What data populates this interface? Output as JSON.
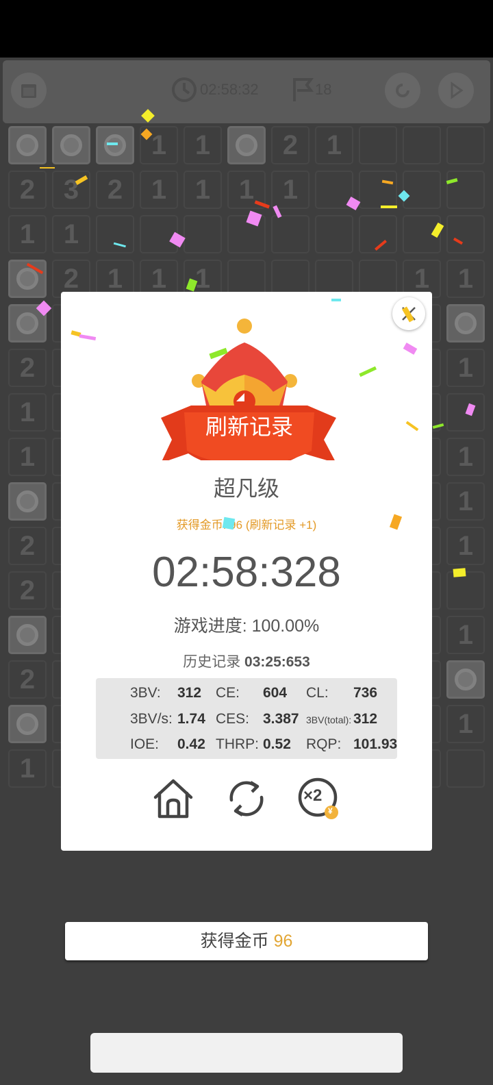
{
  "toolbar": {
    "timer": "02:58:32",
    "flags": "18"
  },
  "board": {
    "rows": [
      [
        "c",
        "c",
        "c",
        "1",
        "1",
        "c",
        "2",
        "1",
        "",
        "",
        ""
      ],
      [
        "2",
        "3",
        "2",
        "1",
        "1",
        "1",
        "1",
        "",
        "",
        "",
        ""
      ],
      [
        "1",
        "1",
        "",
        "",
        "",
        "",
        "",
        "",
        "",
        "",
        ""
      ],
      [
        "c",
        "2",
        "1",
        "1",
        "1",
        "",
        "",
        "",
        "",
        "1",
        "1"
      ],
      [
        "c",
        "",
        "",
        "",
        "",
        "",
        "",
        "",
        "",
        "",
        "c"
      ],
      [
        "2",
        "",
        "",
        "",
        "",
        "",
        "",
        "",
        "",
        "",
        "1"
      ],
      [
        "1",
        "",
        "",
        "",
        "",
        "",
        "",
        "",
        "",
        "",
        ""
      ],
      [
        "1",
        "",
        "",
        "",
        "",
        "",
        "",
        "",
        "",
        "",
        "1"
      ],
      [
        "c",
        "",
        "",
        "",
        "",
        "",
        "",
        "",
        "",
        "",
        "1"
      ],
      [
        "2",
        "",
        "",
        "",
        "",
        "",
        "",
        "",
        "",
        "",
        "1"
      ],
      [
        "2",
        "",
        "",
        "",
        "",
        "",
        "",
        "",
        "",
        "",
        ""
      ],
      [
        "c",
        "",
        "",
        "",
        "",
        "",
        "",
        "",
        "",
        "",
        "1"
      ],
      [
        "2",
        "",
        "",
        "",
        "",
        "",
        "",
        "",
        "",
        "",
        "c"
      ],
      [
        "c",
        "",
        "",
        "",
        "",
        "",
        "",
        "",
        "",
        "",
        "1"
      ],
      [
        "1",
        "",
        "",
        "",
        "",
        "",
        "",
        "",
        "",
        "",
        ""
      ]
    ]
  },
  "dialog": {
    "banner_text": "刷新记录",
    "level_name": "超凡级",
    "coins_earned_text": "获得金币: 96 (刷新记录 +1)",
    "time": "02:58:328",
    "progress_label": "游戏进度:",
    "progress_value": "100.00%",
    "history_label": "历史记录",
    "history_value": "03:25:653",
    "stats": {
      "bbbv_label": "3BV:",
      "bbbv": "312",
      "ce_label": "CE:",
      "ce": "604",
      "cl_label": "CL:",
      "cl": "736",
      "bbbvs_label": "3BV/s:",
      "bbbvs": "1.74",
      "ces_label": "CES:",
      "ces": "3.387",
      "bbbv_total_label": "3BV(total):",
      "bbbv_total": "312",
      "ioe_label": "IOE:",
      "ioe": "0.42",
      "thrp_label": "THRP:",
      "thrp": "0.52",
      "rqp_label": "RQP:",
      "rqp": "101.93"
    },
    "actions": {
      "home_icon": "home-icon",
      "restart_icon": "restart-icon",
      "double_icon": "x2-coin-icon",
      "double_text": "×2",
      "coin_symbol": "¥"
    }
  },
  "coin_bar": {
    "label": "获得金币",
    "amount": "96"
  },
  "colors": {
    "accent_orange": "#e39a27",
    "banner_red": "#e23b1b",
    "crown_yellow": "#f7c23b"
  }
}
